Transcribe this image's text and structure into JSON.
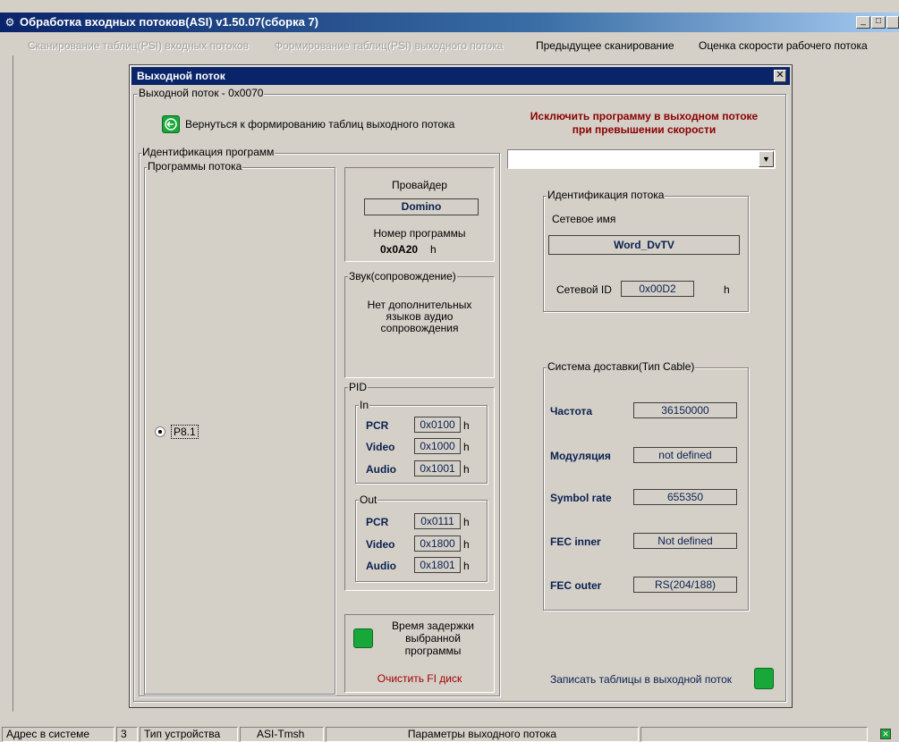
{
  "window": {
    "title": "Обработка входных потоков(ASI)  v1.50.07(сборка 7)",
    "min_glyph": "_",
    "max_glyph": "□"
  },
  "menu": {
    "items": [
      {
        "label": "Сканирование таблиц(PSI) входных потоков",
        "enabled": false
      },
      {
        "label": "Формирование таблиц(PSI) выходного потока",
        "enabled": false
      },
      {
        "label": "Предыдущее сканирование",
        "enabled": true
      },
      {
        "label": "Оценка скорости рабочего потока",
        "enabled": true
      }
    ]
  },
  "dialog": {
    "title": "Выходной поток",
    "close_glyph": "✕",
    "stream_group_label": "Выходной поток - 0x0070",
    "back_button_label": "Вернуться к формированию таблиц выходного потока",
    "exclude_label": "Исключить программу в выходном потоке при превышении скорости",
    "exclude_select_value": "",
    "program_ident_label": "Идентификация программ",
    "programs_group_label": "Программы потока",
    "program_option": "P8.1",
    "provider": {
      "label": "Провайдер",
      "value": "Domino",
      "program_number_label": "Номер программы",
      "program_number_value": "0x0A20",
      "program_number_unit": "h"
    },
    "audio": {
      "group_label": "Звук(сопровождение)",
      "text": "Нет дополнительных языков аудио сопровождения"
    },
    "pid": {
      "group_label": "PID",
      "in_label": "In",
      "out_label": "Out",
      "unit": "h",
      "in": [
        {
          "name": "PCR",
          "value": "0x0100"
        },
        {
          "name": "Video",
          "value": "0x1000"
        },
        {
          "name": "Audio",
          "value": "0x1001"
        }
      ],
      "out": [
        {
          "name": "PCR",
          "value": "0x0111"
        },
        {
          "name": "Video",
          "value": "0x1800"
        },
        {
          "name": "Audio",
          "value": "0x1801"
        }
      ]
    },
    "delay": {
      "label": "Время задержки выбранной программы",
      "clear_label": "Очистить FI диск"
    },
    "stream_ident": {
      "group_label": "Идентификация потока",
      "network_name_label": "Сетевое имя",
      "network_name_value": "Word_DvTV",
      "network_id_label": "Сетевой ID",
      "network_id_value": "0x00D2",
      "network_id_unit": "h"
    },
    "delivery": {
      "group_label": "Система доставки(Тип Cable)",
      "rows": [
        {
          "label": "Частота",
          "value": "36150000"
        },
        {
          "label": "Модуляция",
          "value": "not defined"
        },
        {
          "label": "Symbol rate",
          "value": "655350"
        },
        {
          "label": "FEC inner",
          "value": "Not defined"
        },
        {
          "label": "FEC outer",
          "value": "RS(204/188)"
        }
      ]
    },
    "write_tables_label": "Записать таблицы в выходной поток"
  },
  "statusbar": {
    "address_label": "Адрес в системе",
    "address_value": "3",
    "device_type_label": "Тип устройства",
    "device_type_value": "ASI-Tmsh",
    "message": "Параметры выходного потока"
  },
  "colors": {
    "title_bar": "#0a246a",
    "exclude_text": "#8b0000",
    "clear_text": "#a00000",
    "accent_green": "#18a83a",
    "label_navy": "#0a2050"
  }
}
